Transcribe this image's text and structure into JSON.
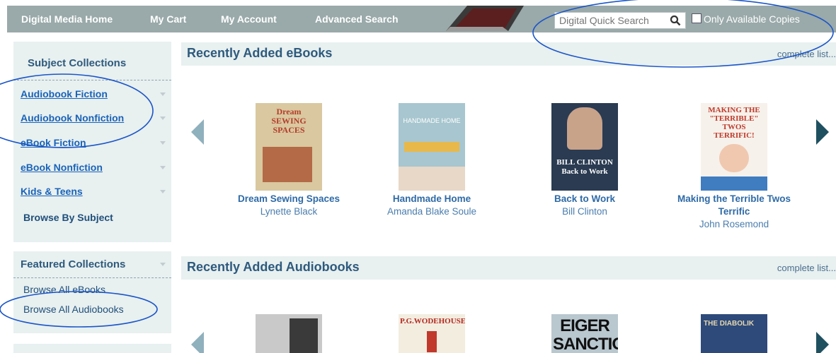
{
  "nav": {
    "home": "Digital Media Home",
    "cart": "My Cart",
    "account": "My Account",
    "advanced": "Advanced Search",
    "search_placeholder": "Digital Quick Search",
    "only_available": "Only Available Copies"
  },
  "sidebar": {
    "subject_title": "Subject Collections",
    "subjects": [
      {
        "label": "Audiobook Fiction"
      },
      {
        "label": "Audiobook Nonfiction"
      },
      {
        "label": "eBook Fiction"
      },
      {
        "label": "eBook Nonfiction"
      },
      {
        "label": "Kids & Teens"
      }
    ],
    "browse_subject": "Browse By Subject",
    "featured_title": "Featured Collections",
    "featured": [
      {
        "label": "Browse All eBooks"
      },
      {
        "label": "Browse All Audiobooks"
      }
    ]
  },
  "ebooks": {
    "title": "Recently Added eBooks",
    "more": "complete list...",
    "items": [
      {
        "title": "Dream Sewing Spaces",
        "title2": "",
        "author": "Lynette Black",
        "cover_text": "Dream SEWING SPACES",
        "cover_color": "#d9c8a0"
      },
      {
        "title": "Handmade Home",
        "title2": "",
        "author": "Amanda Blake Soule",
        "cover_text": "HANDMADE HOME",
        "cover_color": "#a7c6cf"
      },
      {
        "title": "Back to Work",
        "title2": "",
        "author": "Bill Clinton",
        "cover_text": "BILL CLINTON Back to Work",
        "cover_color": "#2a3b52"
      },
      {
        "title": "Making the Terrible Twos",
        "title2": "Terrific",
        "author": "John Rosemond",
        "cover_text": "MAKING THE \"TERRIBLE\" TWOS TERRIFIC!",
        "cover_color": "#f6f1ea"
      }
    ]
  },
  "audiobooks": {
    "title": "Recently Added Audiobooks",
    "more": "complete list...",
    "items": [
      {
        "cover_text": "",
        "cover_color": "#c9c9c9"
      },
      {
        "cover_text": "P.G.WODEHOUSE",
        "cover_color": "#f3ede0"
      },
      {
        "cover_text": "EIGER SANCTION",
        "cover_color": "#b9c7cf"
      },
      {
        "cover_text": "THE DIABOLIK",
        "cover_color": "#2d4a7a"
      }
    ]
  },
  "colors": {
    "nav_bg": "#9aa9a9",
    "panel_bg": "#e8f0f0",
    "heading": "#2e5a7d",
    "link": "#1a63b8",
    "arrow": "#8fb0bd",
    "annotation": "#1a55c8"
  }
}
